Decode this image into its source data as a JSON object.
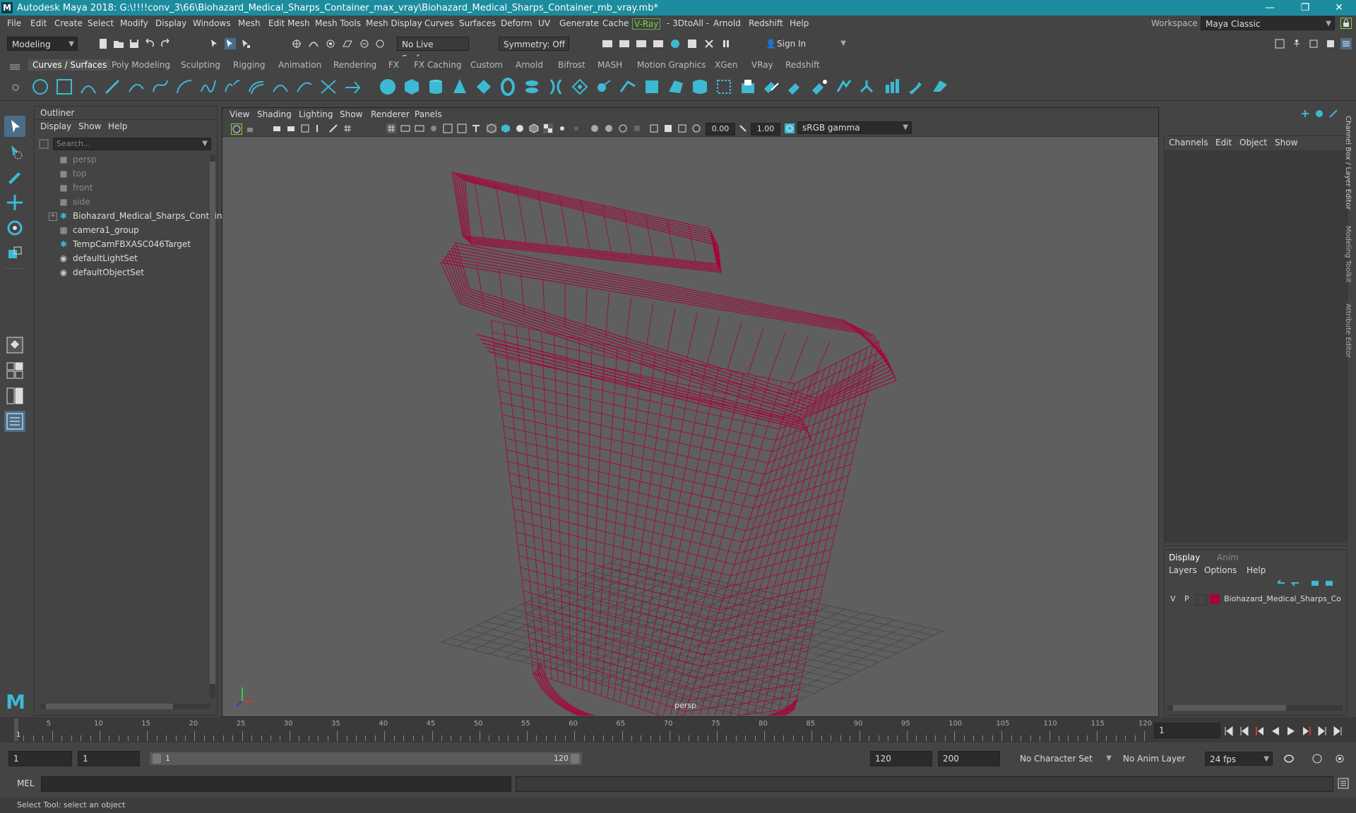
{
  "titlebar": {
    "logo": "M",
    "title": "Autodesk Maya 2018: G:\\!!!!conv_3\\66\\Biohazard_Medical_Sharps_Container_max_vray\\Biohazard_Medical_Sharps_Container_mb_vray.mb*",
    "minimize": "—",
    "maximize": "❐",
    "close": "✕"
  },
  "menubar": {
    "items": [
      "File",
      "Edit",
      "Create",
      "Select",
      "Modify",
      "Display",
      "Windows",
      "Mesh",
      "Edit Mesh",
      "Mesh Tools",
      "Mesh Display",
      "Curves",
      "Surfaces",
      "Deform",
      "UV",
      "Generate",
      "Cache",
      "V-Ray",
      "- 3DtoAll -",
      "Arnold",
      "Redshift",
      "Help"
    ],
    "workspace_label": "Workspace :",
    "workspace_value": "Maya Classic"
  },
  "statusline": {
    "mode": "Modeling",
    "live_surface": "No Live Surface",
    "symmetry": "Symmetry: Off",
    "sign_in": "Sign In"
  },
  "shelf": {
    "tabs": [
      "Curves / Surfaces",
      "Poly Modeling",
      "Sculpting",
      "Rigging",
      "Animation",
      "Rendering",
      "FX",
      "FX Caching",
      "Custom",
      "Arnold",
      "Bifrost",
      "MASH",
      "Motion Graphics",
      "XGen",
      "VRay",
      "Redshift"
    ],
    "active_tab": "Curves / Surfaces"
  },
  "outliner": {
    "title": "Outliner",
    "menu": [
      "Display",
      "Show",
      "Help"
    ],
    "search_placeholder": "Search...",
    "items": [
      {
        "label": "persp",
        "icon": "camera-icon",
        "dim": true
      },
      {
        "label": "top",
        "icon": "camera-icon",
        "dim": true
      },
      {
        "label": "front",
        "icon": "camera-icon",
        "dim": true
      },
      {
        "label": "side",
        "icon": "camera-icon",
        "dim": true
      },
      {
        "label": "Biohazard_Medical_Sharps_Containe",
        "icon": "transform-icon",
        "dim": false,
        "expandable": true
      },
      {
        "label": "camera1_group",
        "icon": "group-icon",
        "dim": false
      },
      {
        "label": "TempCamFBXASC046Target",
        "icon": "transform-icon",
        "dim": false
      },
      {
        "label": "defaultLightSet",
        "icon": "set-icon",
        "dim": false
      },
      {
        "label": "defaultObjectSet",
        "icon": "set-icon",
        "dim": false
      }
    ]
  },
  "viewport": {
    "menu": [
      "View",
      "Shading",
      "Lighting",
      "Show",
      "Renderer",
      "Panels"
    ],
    "exposure": "0.00",
    "gamma": "1.00",
    "colorspace": "sRGB gamma",
    "camera_label": "persp",
    "wire_color": "#a8003a"
  },
  "channelbox": {
    "menu": [
      "Channels",
      "Edit",
      "Object",
      "Show"
    ],
    "side_tabs": [
      "Channel Box / Layer Editor",
      "Modeling Toolkit",
      "Attribute Editor"
    ]
  },
  "layers": {
    "tabs": [
      "Display",
      "Anim"
    ],
    "active_tab": "Display",
    "menu": [
      "Layers",
      "Options",
      "Help"
    ],
    "layer": {
      "v": "V",
      "p": "P",
      "name": "Biohazard_Medical_Sharps_Co",
      "color": "#a8003a"
    }
  },
  "timeline": {
    "ticks": [
      "5",
      "10",
      "15",
      "20",
      "25",
      "30",
      "35",
      "40",
      "45",
      "50",
      "55",
      "60",
      "65",
      "70",
      "75",
      "80",
      "85",
      "90",
      "95",
      "100",
      "105",
      "110",
      "115",
      "120"
    ],
    "start_tick": "1",
    "current_frame": "1"
  },
  "range": {
    "start": "1",
    "playback_start": "1",
    "slider_start": "1",
    "slider_end": "120",
    "playback_end": "120",
    "end": "200",
    "character_set": "No Character Set",
    "anim_layer": "No Anim Layer",
    "fps": "24 fps"
  },
  "cmdline": {
    "label": "MEL"
  },
  "helpline": {
    "text": "Select Tool: select an object"
  }
}
